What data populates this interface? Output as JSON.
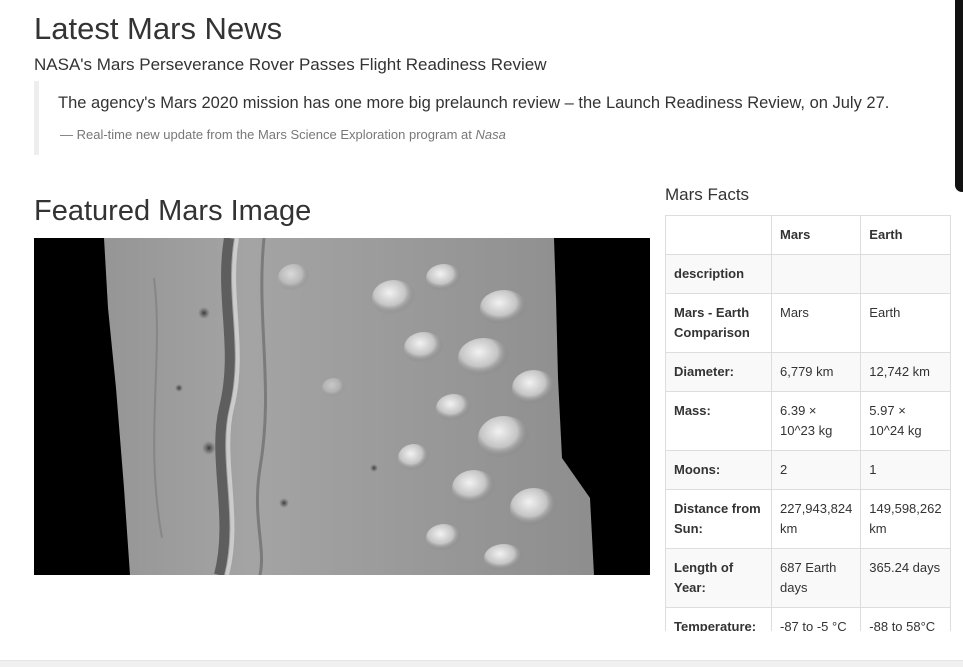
{
  "news": {
    "heading": "Latest Mars News",
    "title": "NASA's Mars Perseverance Rover Passes Flight Readiness Review",
    "paragraph": "The agency's Mars 2020 mission has one more big prelaunch review – the Launch Readiness Review, on July 27.",
    "footer_prefix": "— Real-time new update from the Mars Science Exploration program at ",
    "footer_source": "Nasa"
  },
  "featured_image": {
    "heading": "Featured Mars Image"
  },
  "facts": {
    "heading": "Mars Facts",
    "columns": [
      "",
      "Mars",
      "Earth"
    ],
    "rows": [
      {
        "label": "description",
        "mars": "",
        "earth": ""
      },
      {
        "label": "Mars - Earth Comparison",
        "mars": "Mars",
        "earth": "Earth"
      },
      {
        "label": "Diameter:",
        "mars": "6,779 km",
        "earth": "12,742 km"
      },
      {
        "label": "Mass:",
        "mars": "6.39 × 10^23 kg",
        "earth": "5.97 × 10^24 kg"
      },
      {
        "label": "Moons:",
        "mars": "2",
        "earth": "1"
      },
      {
        "label": "Distance from Sun:",
        "mars": "227,943,824 km",
        "earth": "149,598,262 km"
      },
      {
        "label": "Length of Year:",
        "mars": "687 Earth days",
        "earth": "365.24 days"
      },
      {
        "label": "Temperature:",
        "mars": "-87 to -5 °C",
        "earth": "-88 to 58°C"
      }
    ]
  }
}
